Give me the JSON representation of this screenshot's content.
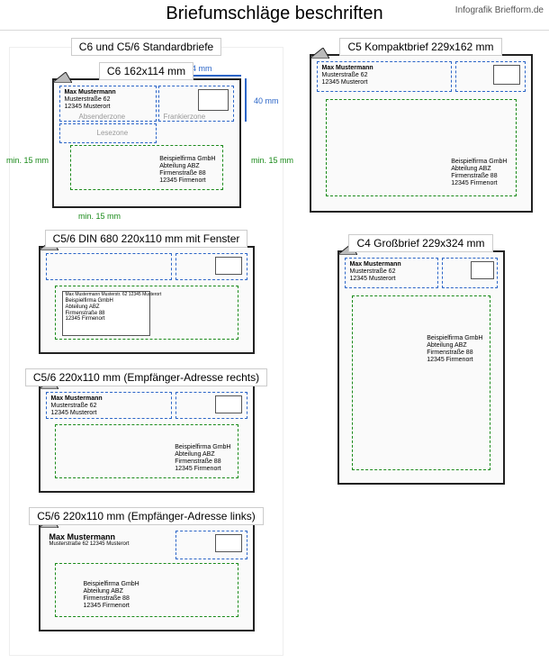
{
  "header": {
    "title": "Briefumschläge beschriften",
    "credit": "Infografik Briefform.de"
  },
  "leftSection": {
    "heading": "C6 und C5/6 Standardbriefe"
  },
  "envelopes": {
    "c6": {
      "heading": "C6 162x114 mm",
      "dim_top": "74 mm",
      "dim_right": "40 mm",
      "dim_left": "min. 15 mm",
      "dim_bottom": "min. 15 mm",
      "dim_rightmargin": "min. 15 mm",
      "zone_sender": "Absenderzone",
      "zone_frank": "Frankierzone",
      "zone_read": "Lesezone"
    },
    "c56win": {
      "heading": "C5/6 DIN 680 220x110 mm mit Fenster"
    },
    "c56r": {
      "heading": "C5/6 220x110 mm (Empfänger-Adresse rechts)"
    },
    "c56l": {
      "heading": "C5/6 220x110 mm (Empfänger-Adresse links)"
    },
    "c5": {
      "heading": "C5 Kompaktbrief 229x162 mm"
    },
    "c4": {
      "heading": "C4 Großbrief 229x324 mm"
    }
  },
  "sender": {
    "l1": "Max Mustermann",
    "l2": "Musterstraße 62",
    "l3": "12345 Musterort",
    "oneline": "Max Mustermann Musterstr. 62 12345 Musterort",
    "oneline2": "Musterstraße 62 12345 Musterort"
  },
  "recipient": {
    "l1": "Beispielfirma GmbH",
    "l2": "Abteilung ABZ",
    "l3": "Firmenstraße 88",
    "l4": "12345 Firmenort"
  }
}
